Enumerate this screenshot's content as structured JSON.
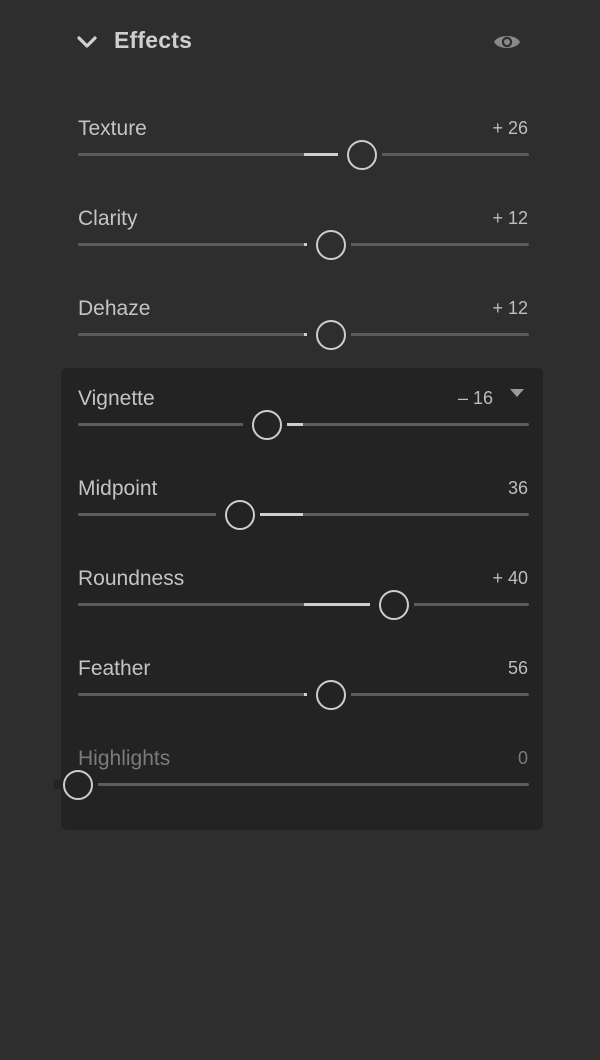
{
  "header": {
    "title": "Effects",
    "expand_icon": "chevron-down-icon",
    "visibility_icon": "eye-icon"
  },
  "sliders": [
    {
      "label": "Texture",
      "display": "+ 26",
      "value": 26,
      "min": -100,
      "max": 100
    },
    {
      "label": "Clarity",
      "display": "+ 12",
      "value": 12,
      "min": -100,
      "max": 100
    },
    {
      "label": "Dehaze",
      "display": "+ 12",
      "value": 12,
      "min": -100,
      "max": 100
    },
    {
      "label": "Vignette",
      "display": "– 16",
      "value": -16,
      "min": -100,
      "max": 100,
      "has_dropdown": true
    },
    {
      "label": "Midpoint",
      "display": "36",
      "value": 36,
      "min": 0,
      "max": 100,
      "default": 50
    },
    {
      "label": "Roundness",
      "display": "+ 40",
      "value": 40,
      "min": -100,
      "max": 100
    },
    {
      "label": "Feather",
      "display": "56",
      "value": 56,
      "min": 0,
      "max": 100,
      "default": 50
    },
    {
      "label": "Highlights",
      "display": "0",
      "value": 0,
      "min": 0,
      "max": 100,
      "disabled": true
    }
  ],
  "colors": {
    "background": "#2e2e2e",
    "group_panel": "#232323",
    "text": "#c4c4c4",
    "track": "#5c5c5c",
    "active": "#cfcfcf"
  }
}
